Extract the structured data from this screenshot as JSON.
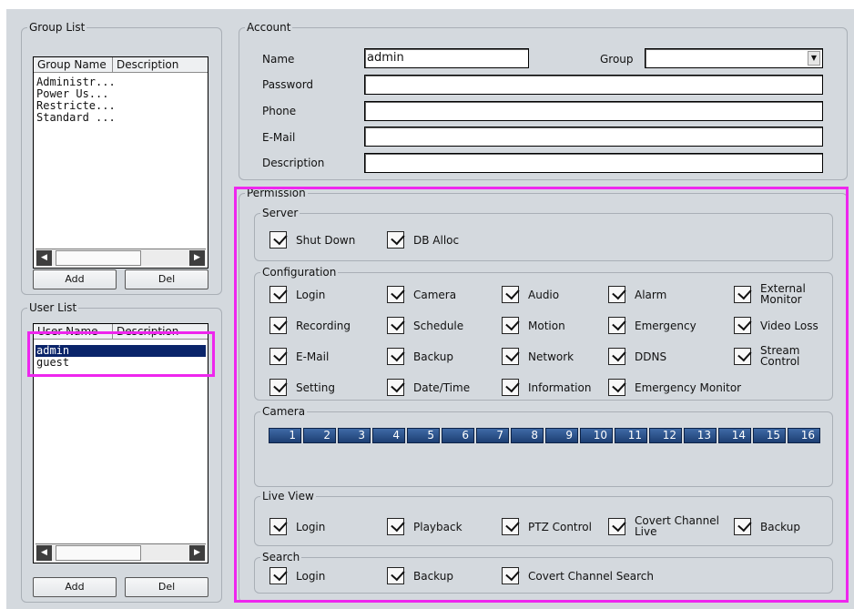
{
  "group_list": {
    "title": "Group List",
    "columns": [
      "Group Name",
      "Description"
    ],
    "items": [
      "Administr...",
      "Power Us...",
      "Restricte...",
      "Standard ..."
    ],
    "add_label": "Add",
    "del_label": "Del"
  },
  "user_list": {
    "title": "User List",
    "columns": [
      "User Name",
      "Description"
    ],
    "items": [
      "admin",
      "guest"
    ],
    "selected": "admin",
    "add_label": "Add",
    "del_label": "Del"
  },
  "account": {
    "title": "Account",
    "name_label": "Name",
    "name_value": "admin",
    "group_label": "Group",
    "group_value": "",
    "password_label": "Password",
    "phone_label": "Phone",
    "email_label": "E-Mail",
    "description_label": "Description"
  },
  "permission": {
    "title": "Permission",
    "server": {
      "title": "Server",
      "items": [
        {
          "label": "Shut Down",
          "checked": true
        },
        {
          "label": "DB Alloc",
          "checked": true
        }
      ]
    },
    "configuration": {
      "title": "Configuration",
      "items": [
        {
          "label": "Login",
          "checked": true
        },
        {
          "label": "Camera",
          "checked": true
        },
        {
          "label": "Audio",
          "checked": true
        },
        {
          "label": "Alarm",
          "checked": true
        },
        {
          "label": "External Monitor",
          "line1": "External",
          "line2": "Monitor",
          "checked": true
        },
        {
          "label": "Recording",
          "checked": true
        },
        {
          "label": "Schedule",
          "checked": true
        },
        {
          "label": "Motion",
          "checked": true
        },
        {
          "label": "Emergency",
          "checked": true
        },
        {
          "label": "Video Loss",
          "checked": true
        },
        {
          "label": "E-Mail",
          "checked": true
        },
        {
          "label": "Backup",
          "checked": true
        },
        {
          "label": "Network",
          "checked": true
        },
        {
          "label": "DDNS",
          "checked": true
        },
        {
          "label": "Stream Control",
          "line1": "Stream",
          "line2": "Control",
          "checked": true
        },
        {
          "label": "Setting",
          "checked": true
        },
        {
          "label": "Date/Time",
          "checked": true
        },
        {
          "label": "Information",
          "checked": true
        },
        {
          "label": "Emergency Monitor",
          "checked": true
        }
      ]
    },
    "camera": {
      "title": "Camera",
      "buttons": [
        "1",
        "2",
        "3",
        "4",
        "5",
        "6",
        "7",
        "8",
        "9",
        "10",
        "11",
        "12",
        "13",
        "14",
        "15",
        "16"
      ]
    },
    "live_view": {
      "title": "Live View",
      "items": [
        {
          "label": "Login",
          "checked": true
        },
        {
          "label": "Playback",
          "checked": true
        },
        {
          "label": "PTZ Control",
          "checked": true
        },
        {
          "label": "Covert Channel Live",
          "line1": "Covert Channel",
          "line2": "Live",
          "checked": true
        },
        {
          "label": "Backup",
          "checked": true
        }
      ]
    },
    "search": {
      "title": "Search",
      "items": [
        {
          "label": "Login",
          "checked": true
        },
        {
          "label": "Backup",
          "checked": true
        },
        {
          "label": "Covert Channel Search",
          "checked": true
        }
      ]
    }
  },
  "colors": {
    "background": "#d4d9de",
    "highlight": "#ee26ee",
    "camera_button": "#2a4f88",
    "selection": "#0a246a"
  }
}
